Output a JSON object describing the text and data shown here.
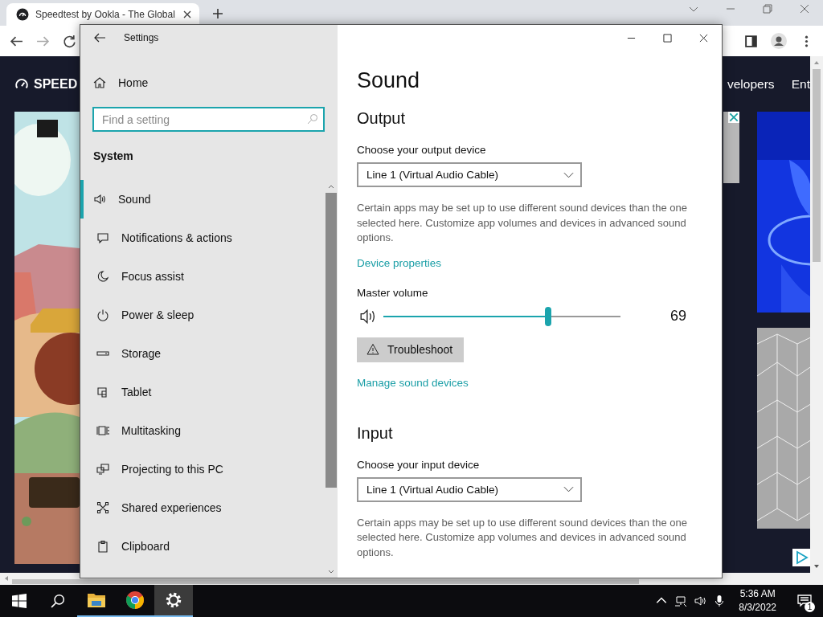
{
  "browser": {
    "tab": {
      "title": "Speedtest by Ookla - The Global",
      "selected": true
    },
    "page": {
      "logo": "SPEED",
      "nav": [
        "velopers",
        "Ent"
      ]
    }
  },
  "settings": {
    "title": "Settings",
    "home": "Home",
    "search": {
      "placeholder": "Find a setting"
    },
    "section": "System",
    "items": [
      {
        "label": "Sound",
        "selected": true
      },
      {
        "label": "Notifications & actions",
        "selected": false
      },
      {
        "label": "Focus assist",
        "selected": false
      },
      {
        "label": "Power & sleep",
        "selected": false
      },
      {
        "label": "Storage",
        "selected": false
      },
      {
        "label": "Tablet",
        "selected": false
      },
      {
        "label": "Multitasking",
        "selected": false
      },
      {
        "label": "Projecting to this PC",
        "selected": false
      },
      {
        "label": "Shared experiences",
        "selected": false
      },
      {
        "label": "Clipboard",
        "selected": false
      }
    ],
    "content": {
      "heading": "Sound",
      "output": {
        "heading": "Output",
        "device_label": "Choose your output device",
        "device": "Line 1 (Virtual Audio Cable)",
        "description": "Certain apps may be set up to use different sound devices than the one selected here. Customize app volumes and devices in advanced sound options.",
        "link": "Device properties"
      },
      "master_volume": {
        "label": "Master volume",
        "level": 0.69,
        "reading": "69"
      },
      "troubleshoot": "Troubleshoot",
      "manage_link": "Manage sound devices",
      "input": {
        "heading": "Input",
        "device_label": "Choose your input device",
        "device": "Line 1 (Virtual Audio Cable)",
        "description": "Certain apps may be set up to use different sound devices than the one selected here. Customize app volumes and devices in advanced sound options."
      }
    }
  },
  "taskbar": {
    "apps": [
      {
        "running": true,
        "selected": false
      },
      {
        "running": true,
        "selected": false
      },
      {
        "running": true,
        "selected": true
      }
    ],
    "time": "5:36 AM",
    "date": "8/3/2022",
    "notifications": "1"
  }
}
